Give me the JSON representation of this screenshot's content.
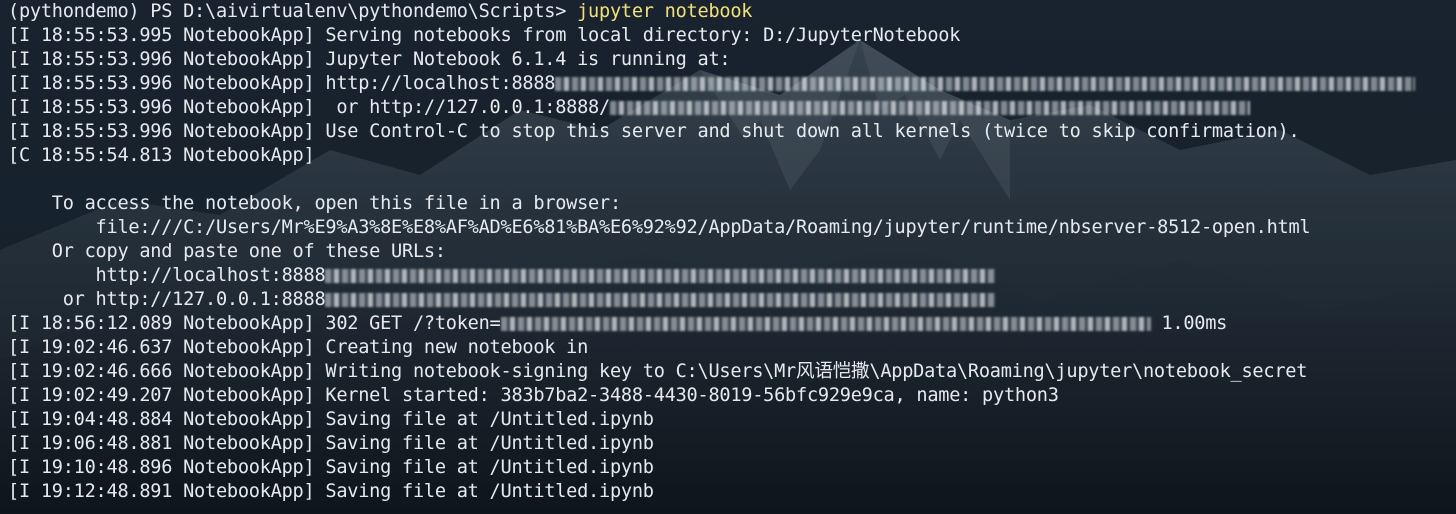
{
  "terminal": {
    "prompt": "(pythondemo) PS D:\\aivirtualenv\\pythondemo\\Scripts> ",
    "command": "jupyter notebook",
    "lines": [
      "[I 18:55:53.995 NotebookApp] Serving notebooks from local directory: D:/JupyterNotebook",
      "[I 18:55:53.996 NotebookApp] Jupyter Notebook 6.1.4 is running at:",
      "[I 18:55:53.996 NotebookApp] http://localhost:8888",
      "[I 18:55:53.996 NotebookApp]  or http://127.0.0.1:8888/",
      "[I 18:55:53.996 NotebookApp] Use Control-C to stop this server and shut down all kernels (twice to skip confirmation).",
      "[C 18:55:54.813 NotebookApp]",
      "",
      "    To access the notebook, open this file in a browser:",
      "        file:///C:/Users/Mr%E9%A3%8E%E8%AF%AD%E6%81%BA%E6%92%92/AppData/Roaming/jupyter/runtime/nbserver-8512-open.html",
      "    Or copy and paste one of these URLs:",
      "        http://localhost:8888",
      "     or http://127.0.0.1:8888",
      "[I 18:56:12.089 NotebookApp] 302 GET /?token=",
      "[I 19:02:46.637 NotebookApp] Creating new notebook in",
      "[I 19:02:46.666 NotebookApp] Writing notebook-signing key to C:\\Users\\Mr风语恺撒\\AppData\\Roaming\\jupyter\\notebook_secret",
      "[I 19:02:49.207 NotebookApp] Kernel started: 383b7ba2-3488-4430-8019-56bfc929e9ca, name: python3",
      "[I 19:04:48.884 NotebookApp] Saving file at /Untitled.ipynb",
      "[I 19:06:48.881 NotebookApp] Saving file at /Untitled.ipynb",
      "[I 19:10:48.896 NotebookApp] Saving file at /Untitled.ipynb",
      "[I 19:12:48.891 NotebookApp] Saving file at /Untitled.ipynb"
    ],
    "token_suffix": " 1.00ms"
  },
  "colors": {
    "text": "#e6eaee",
    "command": "#f2e07a",
    "background": "#17232e"
  }
}
